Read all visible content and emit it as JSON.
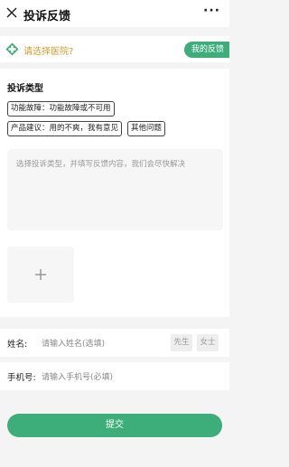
{
  "header": {
    "title": "投诉反馈",
    "more_label": "···"
  },
  "hospital": {
    "prompt": "请选择医院?",
    "my_feedback_label": "我的反馈"
  },
  "complaint": {
    "section_title": "投诉类型",
    "tags": [
      "功能故障：功能故障或不可用",
      "产品建议：用的不爽，我有意见",
      "其他问题"
    ],
    "content_placeholder": "选择投诉类型，并填写反馈内容，我们会尽快解决",
    "upload_symbol": "+"
  },
  "name_row": {
    "label": "姓名:",
    "placeholder": "请输入姓名(选填)",
    "gender_options": [
      "先生",
      "女士"
    ]
  },
  "phone_row": {
    "label": "手机号:",
    "placeholder": "请输入手机号(必填)"
  },
  "submit_label": "提交",
  "colors": {
    "accent": "#3dae7a",
    "hospital_text": "#d89a2c",
    "background": "#f4f4f4"
  }
}
